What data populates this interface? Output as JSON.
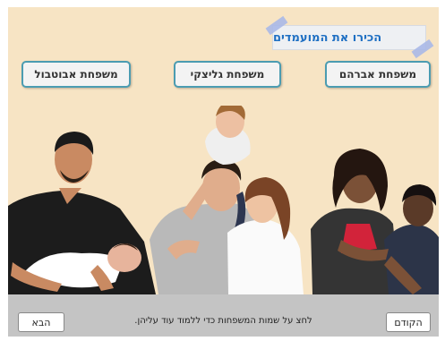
{
  "title": "הכירו את המועמדים",
  "families": {
    "avraham": "משפחת אברהם",
    "galitzki": "משפחת גליצקי",
    "avutbul": "משפחת אבוטבול"
  },
  "photos": {
    "left": "father-with-baby-photo",
    "center": "family-with-child-on-shoulders-photo",
    "right": "mother-with-son-photo"
  },
  "footer": {
    "instruction": "לחצ על שמות המשפחות כדי ללמוד עוד עליהן.",
    "next_label": "הבא",
    "prev_label": "הקודם"
  },
  "colors": {
    "background": "#f7e4c4",
    "title_text": "#1e6fc3",
    "button_border": "#4b9cb1",
    "footer_bar": "#c4c4c4"
  }
}
